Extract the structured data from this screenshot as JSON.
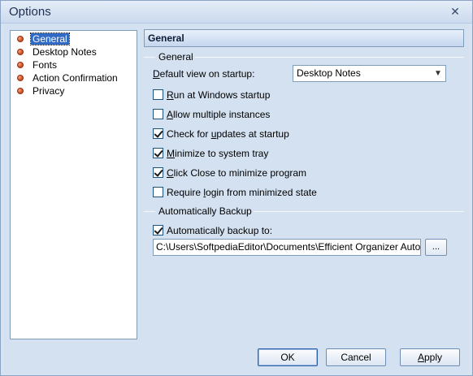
{
  "window": {
    "title": "Options",
    "close_glyph": "✕"
  },
  "tree": {
    "items": [
      {
        "label": "General",
        "selected": true
      },
      {
        "label": "Desktop Notes",
        "selected": false
      },
      {
        "label": "Fonts",
        "selected": false
      },
      {
        "label": "Action Confirmation",
        "selected": false
      },
      {
        "label": "Privacy",
        "selected": false
      }
    ]
  },
  "panel": {
    "header": "General",
    "general_group": "General",
    "default_view": {
      "label_pre": "",
      "label_u": "D",
      "label_post": "efault view on startup:",
      "value": "Desktop Notes"
    },
    "checkboxes": [
      {
        "pre": "",
        "u": "R",
        "post": "un at Windows startup",
        "checked": false
      },
      {
        "pre": "",
        "u": "A",
        "post": "llow multiple instances",
        "checked": false
      },
      {
        "pre": "Check for ",
        "u": "u",
        "post": "pdates at startup",
        "checked": true
      },
      {
        "pre": "",
        "u": "M",
        "post": "inimize to system tray",
        "checked": true
      },
      {
        "pre": "",
        "u": "C",
        "post": "lick Close to minimize program",
        "checked": true
      },
      {
        "pre": "Require ",
        "u": "l",
        "post": "ogin from minimized state",
        "checked": false
      }
    ],
    "backup_group": "Automatically Backup",
    "backup_checkbox": {
      "pre": "Automatically backup to:",
      "u": "",
      "post": "",
      "checked": true
    },
    "backup_path": "C:\\Users\\SoftpediaEditor\\Documents\\Efficient Organizer AutoBacku",
    "browse_label": "..."
  },
  "buttons": {
    "ok": "OK",
    "cancel": "Cancel",
    "apply_u": "A",
    "apply_post": "pply"
  },
  "colors": {
    "accent": "#316ac5",
    "window_bg": "#d4e1f1",
    "bullet": "#c8421a"
  }
}
